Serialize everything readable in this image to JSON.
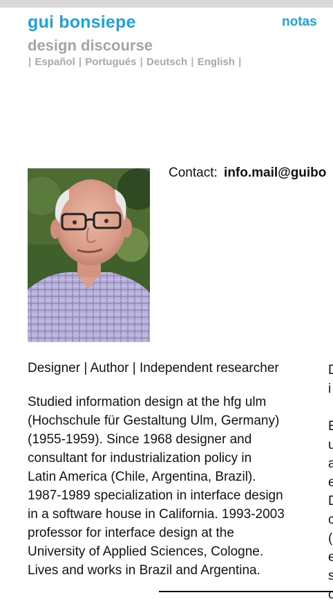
{
  "header": {
    "title": "gui bonsiepe",
    "subtitle": "design discourse",
    "notas_link": "notas",
    "languages": [
      "Español",
      "Portugués",
      "Deutsch",
      "English"
    ],
    "separator": "|"
  },
  "contact": {
    "label": "Contact:",
    "email": "info.mail@guibo"
  },
  "profile": {
    "roles": "Designer | Author | Independent researcher",
    "bio_lines": [
      "Studied information design at the hfg ulm",
      "(Hochschule für Gestaltung Ulm, Germany)",
      "(1955-1959). Since 1968 designer and",
      "consultant for industrialization policy in",
      "Latin America (Chile, Argentina, Brazil).",
      "1987-1989 specialization in interface design",
      "in a software house in California. 1993-2003",
      "professor for interface design at the",
      "University of Applied Sciences, Cologne.",
      "Lives and works in Brazil and Argentina."
    ]
  },
  "right_column_fragments": [
    "D",
    "i",
    "",
    "E",
    "u",
    "a",
    "e",
    "D",
    "c",
    "(",
    "e",
    "s",
    "c"
  ],
  "colors": {
    "accent": "#1aa3dc",
    "subtitle_gray": "#a4a4a4",
    "lang_gray": "#b4b4b4",
    "topbar": "#d9d9d9"
  },
  "icons": {
    "photo": "portrait-photo"
  }
}
